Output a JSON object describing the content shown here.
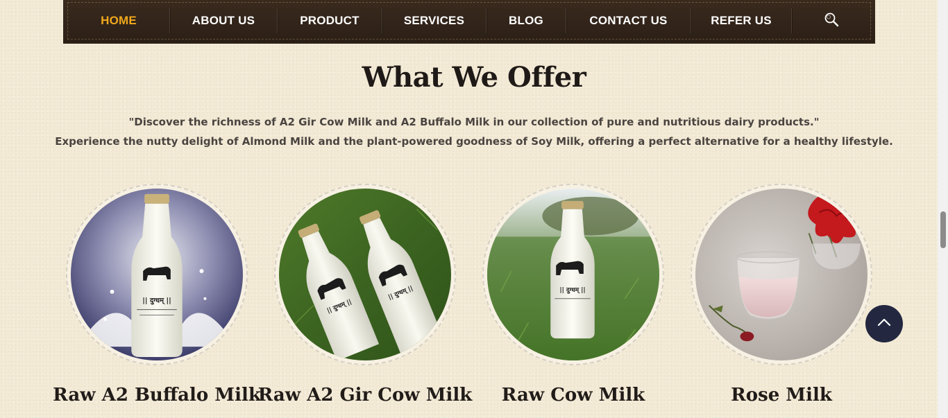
{
  "nav": {
    "items": [
      {
        "label": "HOME",
        "active": true
      },
      {
        "label": "ABOUT US"
      },
      {
        "label": "PRODUCT"
      },
      {
        "label": "SERVICES"
      },
      {
        "label": "BLOG"
      },
      {
        "label": "CONTACT US"
      },
      {
        "label": "REFER US"
      }
    ],
    "search_icon": "search-icon",
    "accent_color": "#f0a81c",
    "background_color": "#2b1f16"
  },
  "section": {
    "title": "What We Offer",
    "intro_line1": "\"Discover the richness of A2 Gir Cow Milk and A2 Buffalo Milk in our collection of pure and nutritious dairy products.\"",
    "intro_line2": "Experience the nutty delight of Almond Milk and the plant-powered goodness of Soy Milk, offering a perfect alternative for a healthy lifestyle."
  },
  "products": [
    {
      "name": "Raw A2 Buffalo Milk",
      "image": "milk-bottle-splash-image"
    },
    {
      "name": "Raw A2 Gir Cow Milk",
      "image": "two-milk-bottles-grass-image"
    },
    {
      "name": "Raw Cow Milk",
      "image": "milk-bottle-field-image"
    },
    {
      "name": "Rose Milk",
      "image": "rose-milk-glass-image"
    }
  ],
  "bottle_label": "|| दुग्धम् ||",
  "back_to_top_icon": "chevron-up-icon"
}
